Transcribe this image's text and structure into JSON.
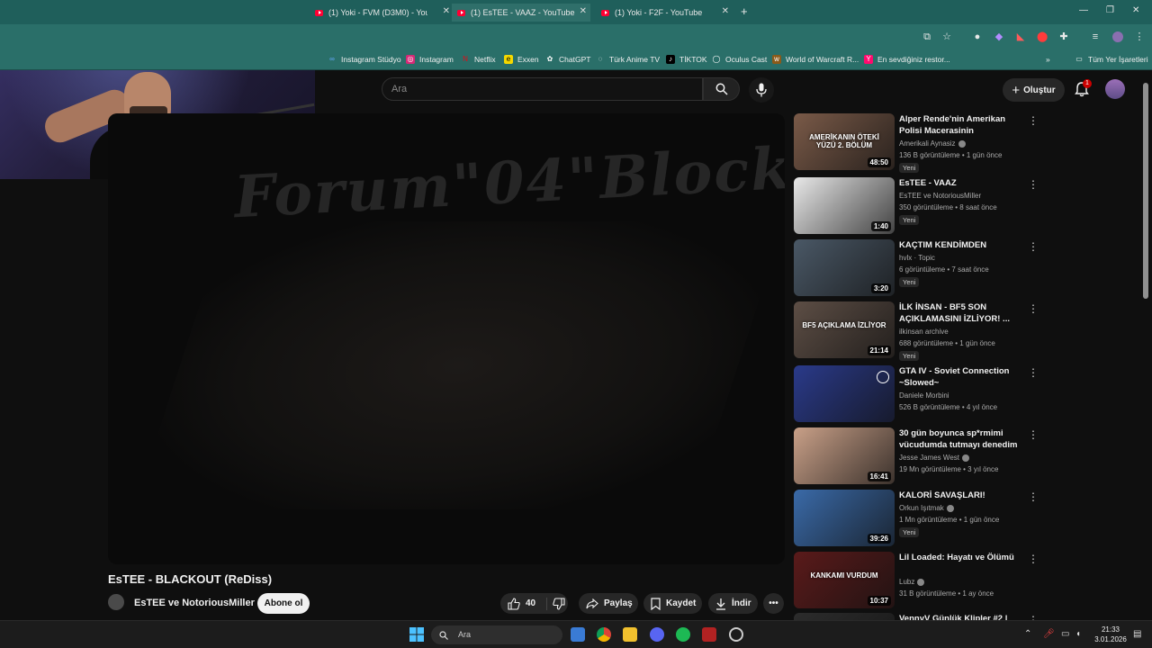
{
  "browser": {
    "tabs": [
      {
        "title": "(1) Yoki - FVM (D3M0) - YouTube"
      },
      {
        "title": "(1) EsTEE - VAAZ - YouTube"
      },
      {
        "title": "(1) Yoki - F2F - YouTube"
      }
    ],
    "bookmarks": [
      "Instagram Stüdyo",
      "Instagram",
      "Netflix",
      "Exxen",
      "ChatGPT",
      "Türk Anime TV",
      "TİKTOK",
      "Oculus Cast",
      "World of Warcraft R...",
      "En sevdiğiniz restor..."
    ],
    "all_bookmarks": "Tüm Yer İşaretleri"
  },
  "header": {
    "search_placeholder": "Ara",
    "create_label": "Oluştur",
    "notification_count": "1"
  },
  "video": {
    "title": "EsTEE - BLACKOUT (ReDiss)",
    "channel": "EsTEE ve NotoriousMiller",
    "subscribe_label": "Abone ol",
    "like_count": "40",
    "share_label": "Paylaş",
    "save_label": "Kaydet",
    "download_label": "İndir",
    "frame_text": "Forum\"04\"Block"
  },
  "recommendations": [
    {
      "title": "Alper Rende'nin Amerikan Polisi Macerasinin Yorumluyorum! 2....",
      "channel": "Amerikali Aynasiz",
      "verified": true,
      "meta": "136 B görüntüleme • 1 gün önce",
      "badge": "Yeni",
      "duration": "48:50",
      "thumb_color": "#7a5a48",
      "thumb_text": "AMERİKANIN ÖTEKİ YÜZÜ 2. BÖLÜM"
    },
    {
      "title": "EsTEE - VAAZ",
      "channel": "EsTEE ve NotoriousMiller",
      "verified": false,
      "meta": "350 görüntüleme • 8 saat önce",
      "badge": "Yeni",
      "duration": "1:40",
      "thumb_color": "#e8e8e8",
      "thumb_text": ""
    },
    {
      "title": "KAÇTIM KENDİMDEN",
      "channel": "hvlx · Topic",
      "verified": false,
      "meta": "6 görüntüleme • 7 saat önce",
      "badge": "Yeni",
      "duration": "3:20",
      "thumb_color": "#4a5866",
      "thumb_text": ""
    },
    {
      "title": "İLK İNSAN - BF5 SON AÇIKLAMASINI İZLİYOR! ...",
      "channel": "ilkinsan archive",
      "verified": false,
      "meta": "688 görüntüleme • 1 gün önce",
      "badge": "Yeni",
      "duration": "21:14",
      "thumb_color": "#5d4e45",
      "thumb_text": "BF5 AÇIKLAMA İZLİYOR"
    },
    {
      "title": "GTA IV - Soviet Connection ~Slowed~",
      "channel": "Daniele Morbini",
      "verified": false,
      "meta": "526 B görüntüleme • 4 yıl önce",
      "badge": "",
      "duration": "",
      "thumb_color": "#2a3a8a",
      "thumb_text": ""
    },
    {
      "title": "30 gün boyunca sp*rmimi vücudumda tutmayı denedim ...",
      "channel": "Jesse James West",
      "verified": true,
      "meta": "19 Mn görüntüleme • 3 yıl önce",
      "badge": "",
      "duration": "16:41",
      "thumb_color": "#c9a088",
      "thumb_text": ""
    },
    {
      "title": "KALORİ SAVAŞLARI!",
      "channel": "Orkun Işıtmak",
      "verified": true,
      "meta": "1 Mn görüntüleme • 1 gün önce",
      "badge": "Yeni",
      "duration": "39:26",
      "thumb_color": "#3a6aa8",
      "thumb_text": ""
    },
    {
      "title": "Lil Loaded: Hayatı ve Ölümü",
      "channel": "Lubz",
      "verified": true,
      "meta": "31 B görüntüleme • 1 ay önce",
      "badge": "",
      "duration": "10:37",
      "thumb_color": "#5a1a1a",
      "thumb_text": "KANKAMI VURDUM"
    },
    {
      "title": "VennyV Günlük Klipler #2 |",
      "channel": "",
      "verified": false,
      "meta": "",
      "badge": "",
      "duration": "#2",
      "thumb_color": "#2c2c2c",
      "thumb_text": ""
    }
  ],
  "taskbar": {
    "search_placeholder": "Ara",
    "time": "21:33",
    "date": "3.01.2026"
  }
}
